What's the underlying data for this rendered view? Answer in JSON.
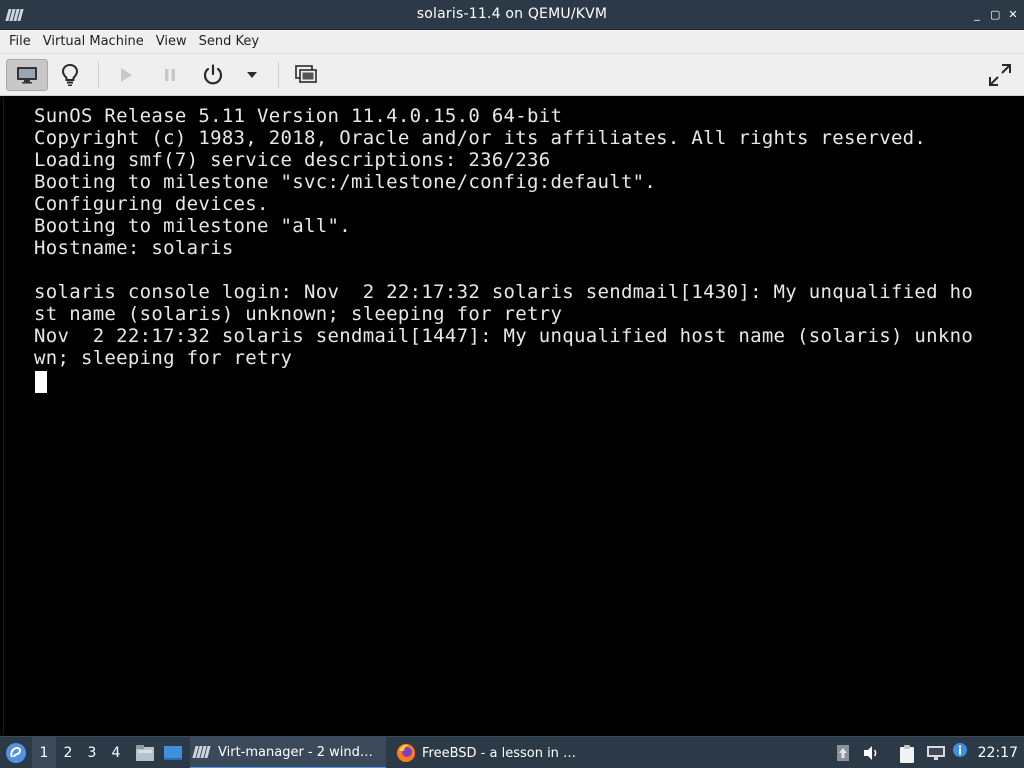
{
  "window": {
    "title": "solaris-11.4 on QEMU/KVM",
    "controls": {
      "minimize": "_",
      "maximize": "▢",
      "close": "✕"
    }
  },
  "menubar": {
    "items": [
      "File",
      "Virtual Machine",
      "View",
      "Send Key"
    ]
  },
  "toolbar": {
    "buttons": [
      {
        "icon": "monitor-icon",
        "action": "show-console",
        "active": true
      },
      {
        "icon": "lightbulb-icon",
        "action": "show-details"
      },
      {
        "icon": "play-icon",
        "action": "run",
        "disabled": true
      },
      {
        "icon": "pause-icon",
        "action": "pause",
        "disabled": true
      },
      {
        "icon": "power-icon",
        "action": "shutdown"
      },
      {
        "icon": "chevron-down-icon",
        "action": "shutdown-menu"
      },
      {
        "icon": "snapshots-icon",
        "action": "manage-snapshots"
      },
      {
        "icon": "fullscreen-icon",
        "action": "fullscreen"
      }
    ]
  },
  "console": {
    "lines": [
      "SunOS Release 5.11 Version 11.4.0.15.0 64-bit",
      "Copyright (c) 1983, 2018, Oracle and/or its affiliates. All rights reserved.",
      "Loading smf(7) service descriptions: 236/236",
      "Booting to milestone \"svc:/milestone/config:default\".",
      "Configuring devices.",
      "Booting to milestone \"all\".",
      "Hostname: solaris",
      "",
      "solaris console login: Nov  2 22:17:32 solaris sendmail[1430]: My unqualified ho",
      "st name (solaris) unknown; sleeping for retry",
      "Nov  2 22:17:32 solaris sendmail[1447]: My unqualified host name (solaris) unkno",
      "wn; sleeping for retry"
    ]
  },
  "taskbar": {
    "workspaces": [
      "1",
      "2",
      "3",
      "4"
    ],
    "active_workspace": "1",
    "tasks": [
      {
        "label": "Virt-manager - 2 wind…",
        "icon": "virt-manager-icon",
        "active": true
      },
      {
        "label": "FreeBSD - a lesson in …",
        "icon": "firefox-icon",
        "active": false
      }
    ],
    "clock": "22:17"
  },
  "colors": {
    "titlebar": "#2c3a48",
    "taskbar": "#2c3a48",
    "console_bg": "#000000",
    "console_fg": "#e8e8e8",
    "accent": "#5294e2"
  }
}
